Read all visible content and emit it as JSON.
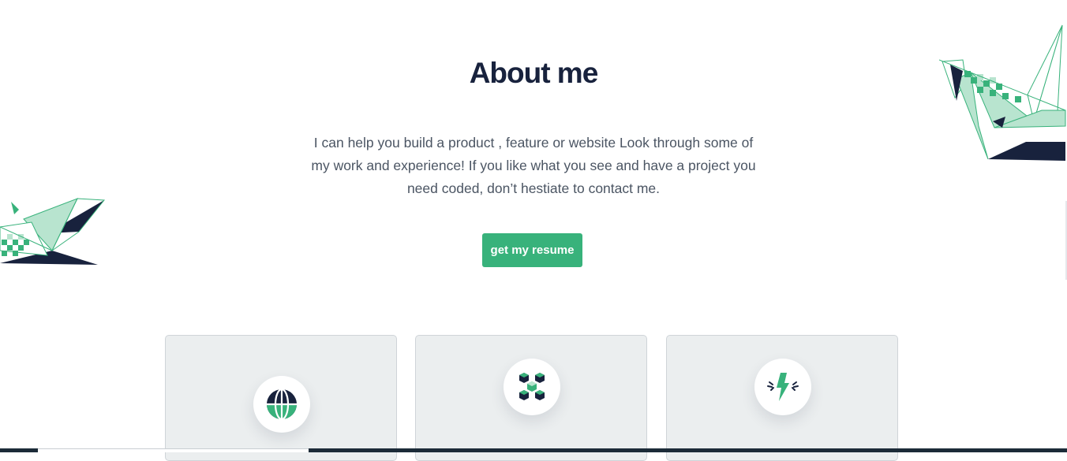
{
  "about": {
    "title": "About me",
    "intro": "I can help you build a product , feature or website Look through some of my work and experience! If you like what you see and have a project you need coded, don’t hestiate to contact me.",
    "resume_label": "get my resume"
  },
  "cards": [
    {
      "icon": "globe-icon"
    },
    {
      "icon": "cubes-icon"
    },
    {
      "icon": "lightning-icon"
    }
  ],
  "colors": {
    "accent": "#38b27b",
    "navy": "#18223d",
    "light_green": "#b8e4cf",
    "card_bg": "#ebeeef",
    "footer": "#1c2b38"
  }
}
